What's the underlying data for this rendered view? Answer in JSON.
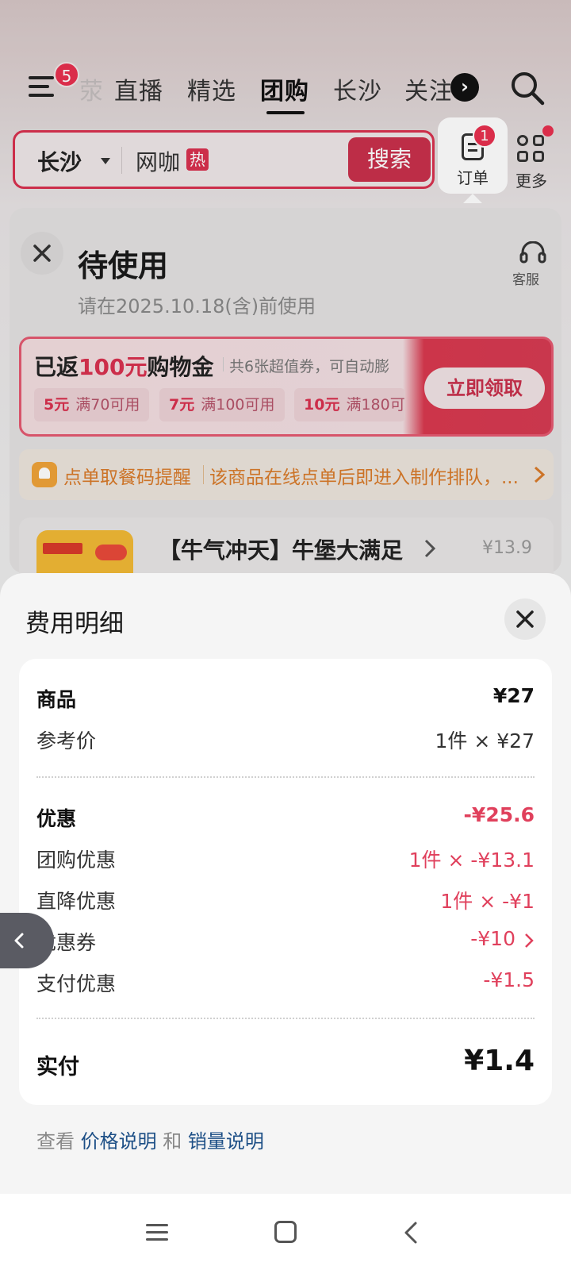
{
  "nav": {
    "menu_badge": "5",
    "tabs": [
      "荥",
      "直播",
      "精选",
      "团购",
      "长沙",
      "关注"
    ],
    "active_tab": "团购"
  },
  "search": {
    "city": "长沙",
    "keyword": "网咖",
    "hot_badge": "热",
    "button": "搜索"
  },
  "orders": {
    "label": "订单",
    "badge": "1"
  },
  "more": {
    "label": "更多"
  },
  "order_status": {
    "title": "待使用",
    "subtitle": "请在2025.10.18(含)前使用",
    "service_label": "客服"
  },
  "promo": {
    "title_prefix": "已返",
    "title_amount": "100元",
    "title_suffix": "购物金",
    "description": "共6张超值券，可自动膨",
    "coupons": [
      {
        "value": "5元",
        "condition": "满70可用"
      },
      {
        "value": "7元",
        "condition": "满100可用"
      },
      {
        "value": "10元",
        "condition": "满180可"
      }
    ],
    "button": "立即领取"
  },
  "notice": {
    "title": "点单取餐码提醒",
    "text": "该商品在线点单后即进入制作排队，..."
  },
  "item": {
    "name": "【牛气冲天】牛堡大满足",
    "price": "¥13.9"
  },
  "sheet": {
    "title": "费用明细",
    "goods_label": "商品",
    "goods_value": "¥27",
    "ref_label": "参考价",
    "ref_value": "1件 × ¥27",
    "discount_label": "优惠",
    "discount_value": "-¥25.6",
    "group_label": "团购优惠",
    "group_value": "1件 × -¥13.1",
    "direct_label": "直降优惠",
    "direct_value": "1件 × -¥1",
    "coupon_label": "优惠券",
    "coupon_value": "-¥10",
    "pay_label": "支付优惠",
    "pay_value": "-¥1.5",
    "paid_label": "实付",
    "paid_value": "¥1.4",
    "links_prefix": "查看",
    "link_price": "价格说明",
    "links_and": "和",
    "link_sales": "销量说明"
  },
  "colors": {
    "accent": "#e0405c",
    "link": "#1d4f86",
    "notice": "#d97b2a"
  }
}
